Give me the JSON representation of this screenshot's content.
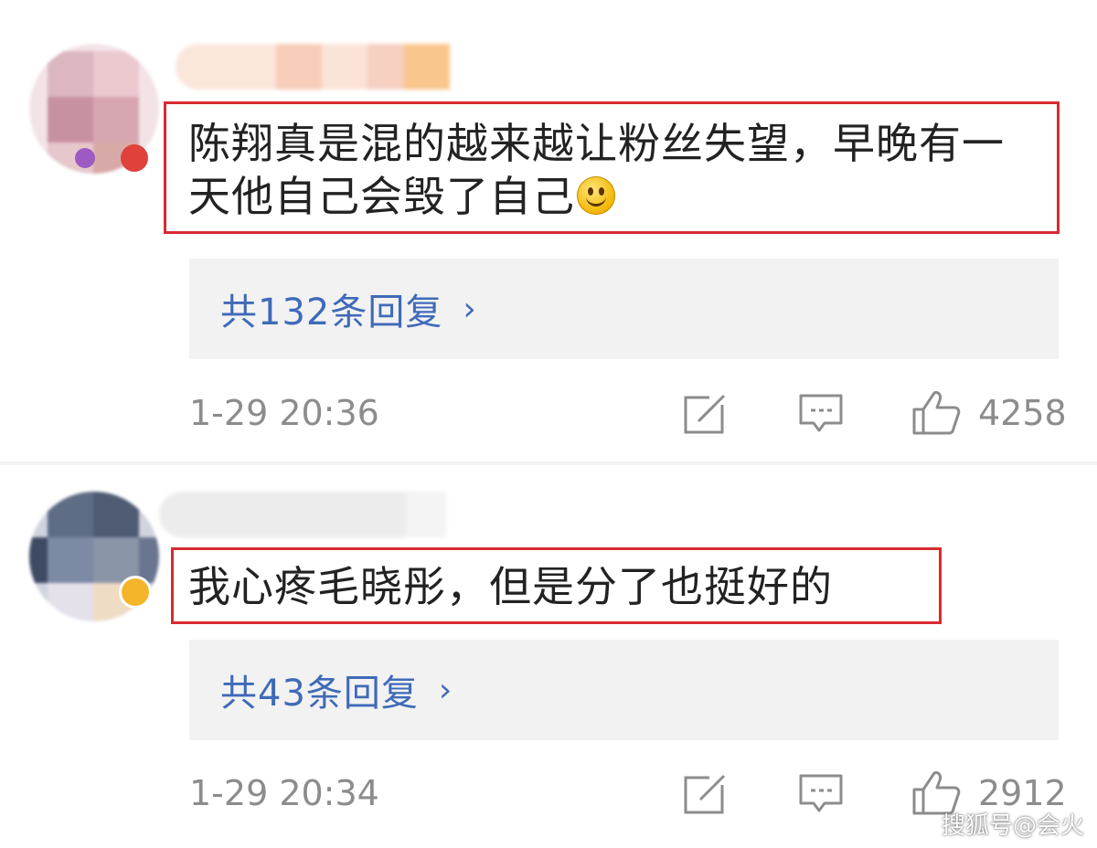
{
  "comments": [
    {
      "text_line1": "陈翔真是混的越来越让粉丝失望，早晚有一",
      "text_line2": "天他自己会毁了自己",
      "emoji": "smile-emoji",
      "replies_label": "共132条回复",
      "timestamp": "1-29 20:36",
      "likes": "4258"
    },
    {
      "text_line1": "我心疼毛晓彤，但是分了也挺好的",
      "replies_label": "共43条回复",
      "timestamp": "1-29 20:34",
      "likes": "2912"
    }
  ],
  "icons": {
    "share": "share-edit-icon",
    "comment": "comment-bubble-icon",
    "like": "thumbs-up-icon",
    "chevron": "›"
  },
  "colors": {
    "highlight_border": "#d72b31",
    "reply_link": "#3f6ab8",
    "meta_text": "#8c8c8c",
    "reply_panel_bg": "#f2f2f2"
  },
  "watermark": "搜狐号@会火"
}
